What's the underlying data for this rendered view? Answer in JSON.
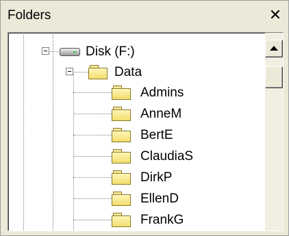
{
  "panel": {
    "title": "Folders",
    "close_glyph": "✕"
  },
  "tree": {
    "drive": {
      "label": "Disk (F:)",
      "icon": "drive-icon",
      "expanded": true
    },
    "data_folder": {
      "label": "Data",
      "icon": "folder-icon",
      "expanded": true
    },
    "subfolders": [
      {
        "label": "Admins",
        "icon": "folder-icon"
      },
      {
        "label": "AnneM",
        "icon": "folder-icon"
      },
      {
        "label": "BertE",
        "icon": "folder-icon"
      },
      {
        "label": "ClaudiaS",
        "icon": "folder-icon"
      },
      {
        "label": "DirkP",
        "icon": "folder-icon"
      },
      {
        "label": "EllenD",
        "icon": "folder-icon"
      },
      {
        "label": "FrankG",
        "icon": "folder-icon"
      }
    ]
  },
  "scrollbar": {
    "up_icon": "arrow-up-icon"
  },
  "colors": {
    "window_bg": "#ece9d8",
    "folder_fill": "#f2dd6e",
    "tree_lines": "#808080"
  }
}
